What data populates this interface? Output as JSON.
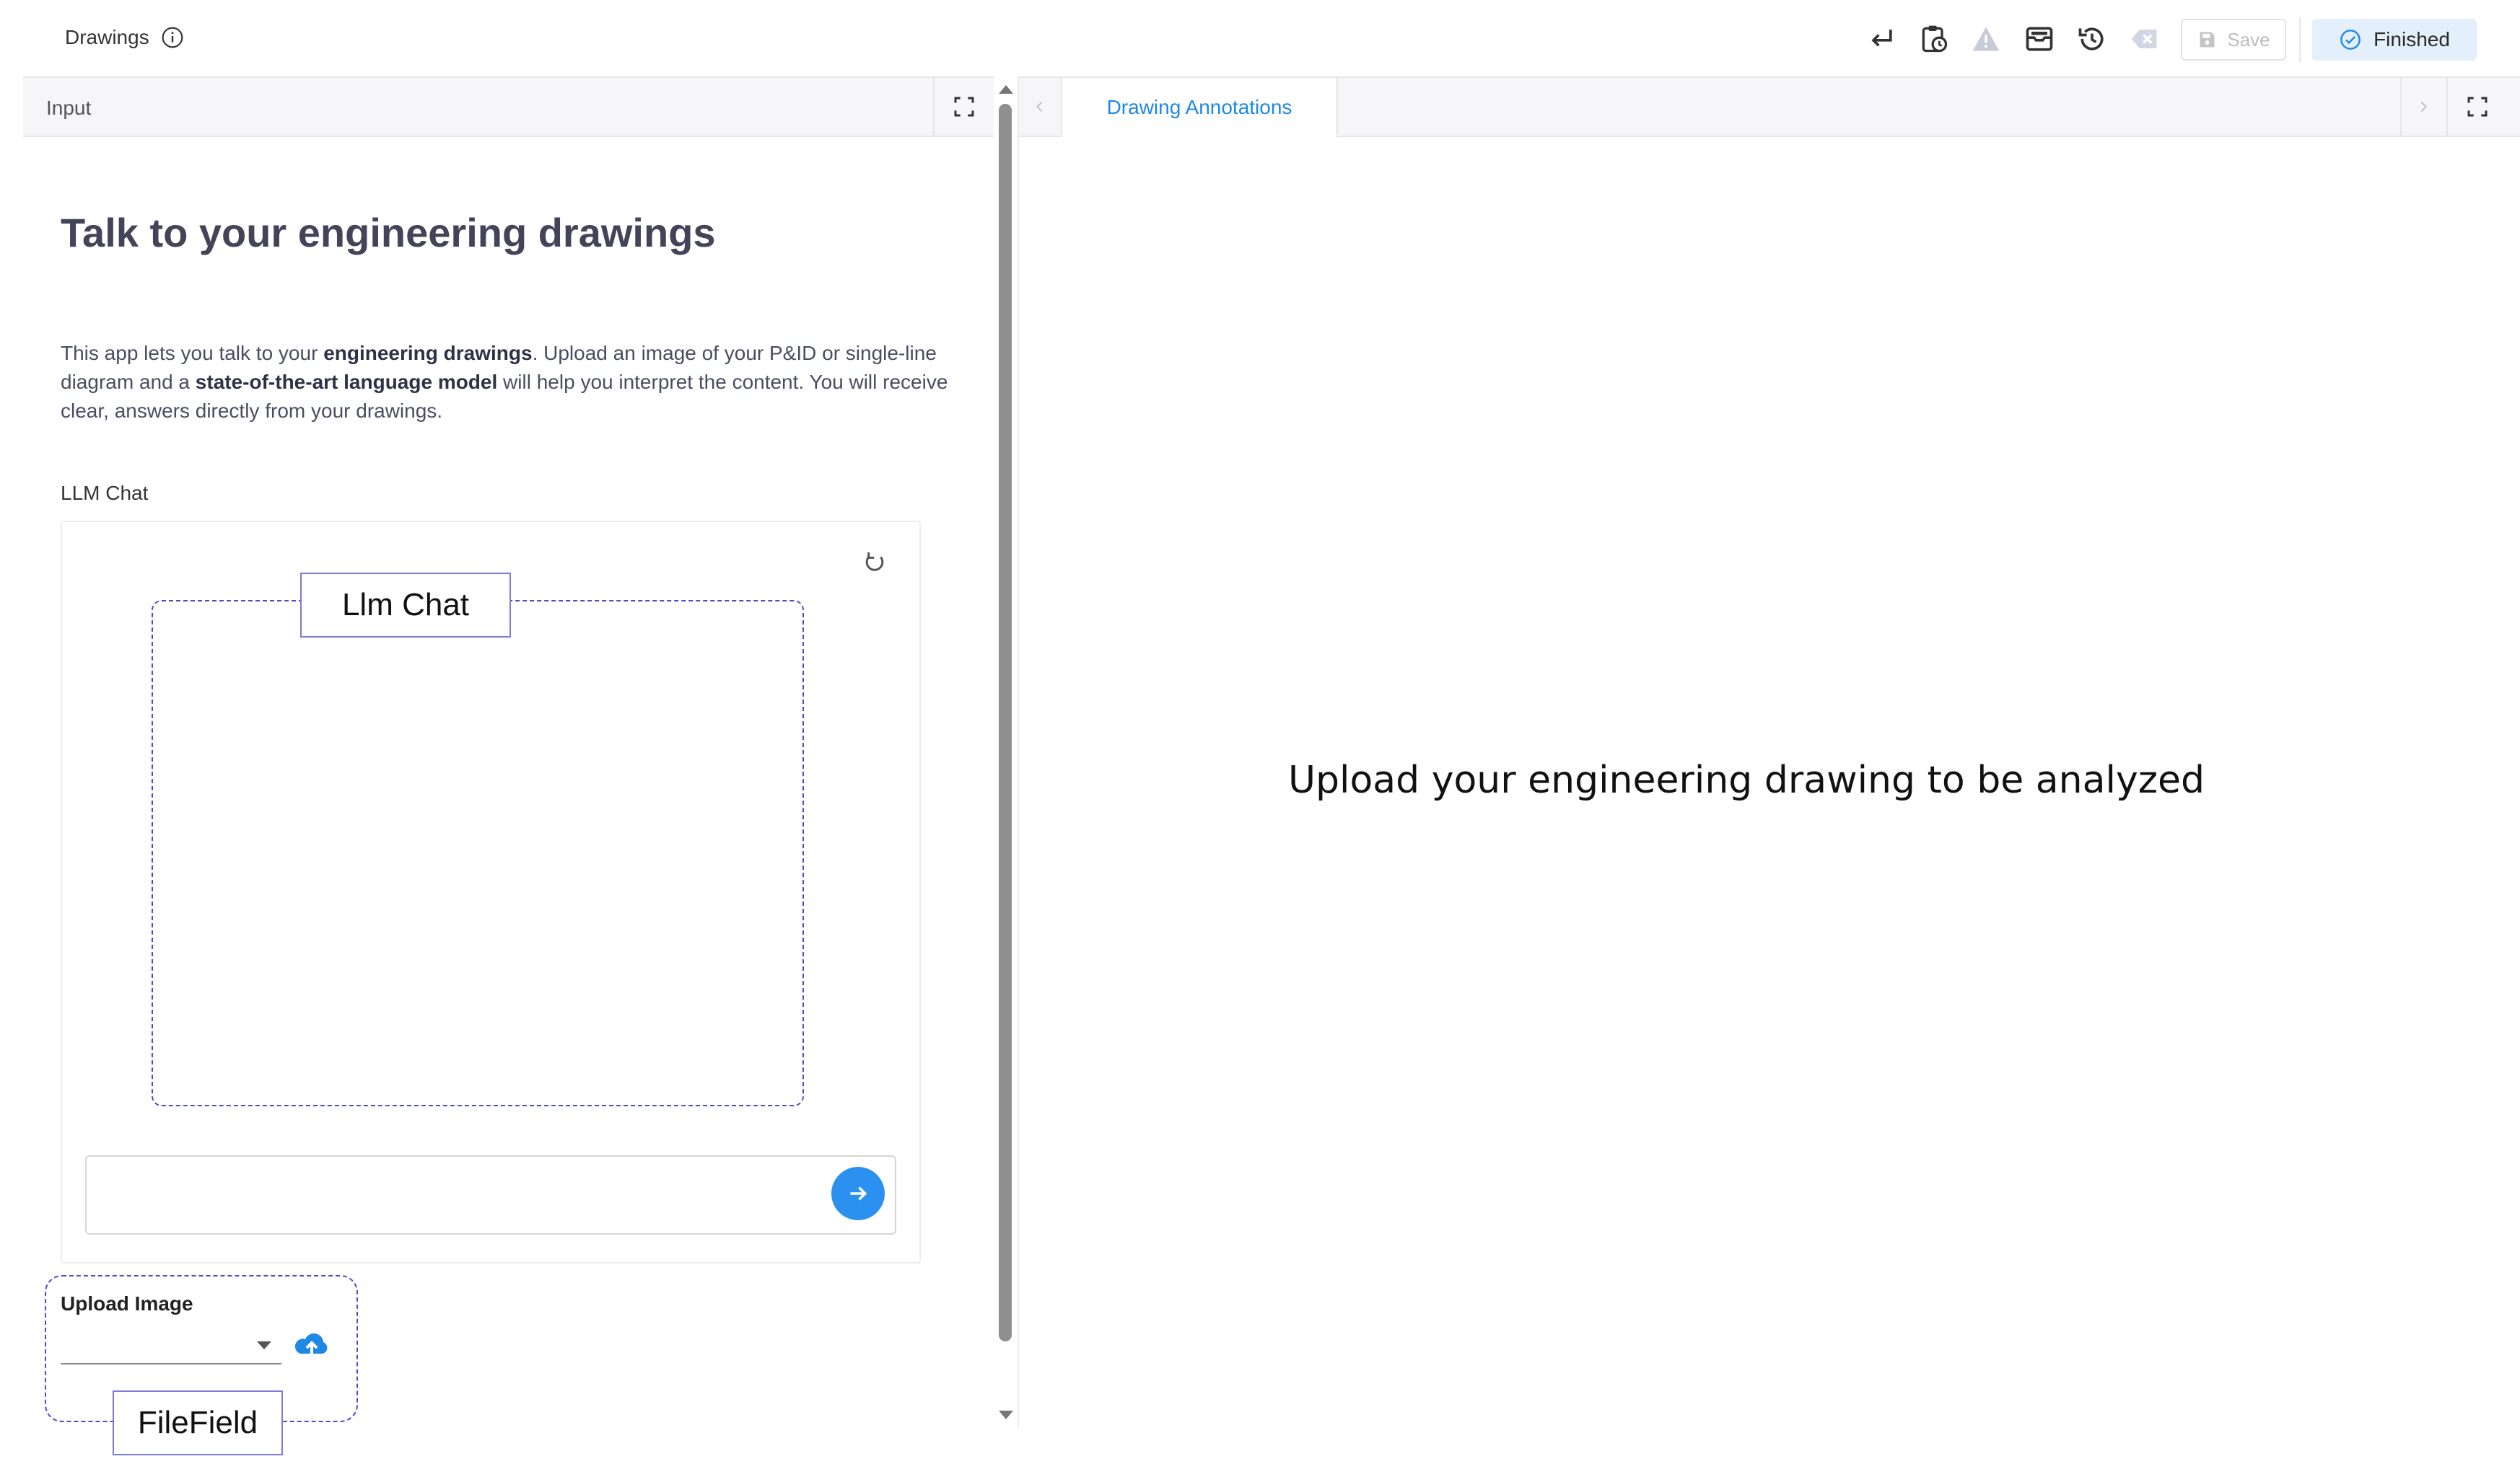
{
  "app": {
    "title": "Drawings"
  },
  "toolbar": {
    "save_label": "Save",
    "finished_label": "Finished",
    "icons": [
      "return-icon",
      "clipboard-clock-icon",
      "warning-icon",
      "inbox-icon",
      "history-icon",
      "clear-icon",
      "floppy-icon",
      "check-circle-icon"
    ]
  },
  "left_panel": {
    "header_label": "Input",
    "title": "Talk to your engineering drawings",
    "intro": {
      "p1": "This app lets you talk to your ",
      "b1": "engineering drawings",
      "p2": ". Upload an image of your P&ID or single-line diagram and a ",
      "b2": "state-of-the-art language model",
      "p3": " will help you interpret the content. You will receive clear, answers directly from your drawings."
    },
    "chat": {
      "label": "LLM Chat",
      "component_tag": "Llm Chat",
      "input_value": ""
    },
    "upload": {
      "label": "Upload Image",
      "selected_value": "",
      "component_tag": "FileField"
    }
  },
  "right_panel": {
    "tab_label": "Drawing Annotations",
    "message": "Upload your engineering drawing to be analyzed"
  },
  "colors": {
    "accent": "#1e88e5",
    "send_button": "#2a91f0",
    "finished_bg": "#e3effb",
    "dashed_outline": "#4b4bcf"
  }
}
